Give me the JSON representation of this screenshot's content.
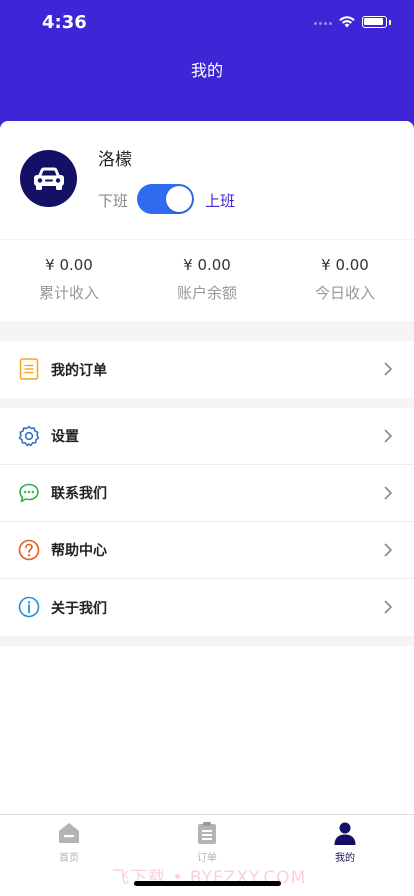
{
  "status_bar": {
    "time": "4:36"
  },
  "header": {
    "title": "我的"
  },
  "profile": {
    "name": "洛檬",
    "status_off_label": "下班",
    "status_on_label": "上班",
    "on_duty": true,
    "avatar_icon": "car-icon"
  },
  "stats": [
    {
      "value": "¥ 0.00",
      "label": "累计收入"
    },
    {
      "value": "¥ 0.00",
      "label": "账户余额"
    },
    {
      "value": "¥ 0.00",
      "label": "今日收入"
    }
  ],
  "menu": {
    "orders": {
      "label": "我的订单",
      "icon": "document-icon"
    },
    "settings": {
      "label": "设置",
      "icon": "gear-icon"
    },
    "contact": {
      "label": "联系我们",
      "icon": "chat-icon"
    },
    "help": {
      "label": "帮助中心",
      "icon": "question-icon"
    },
    "about": {
      "label": "关于我们",
      "icon": "info-icon"
    }
  },
  "tabbar": [
    {
      "label": "首页",
      "icon": "home-icon",
      "active": false
    },
    {
      "label": "订单",
      "icon": "clipboard-icon",
      "active": false
    },
    {
      "label": "我的",
      "icon": "user-icon",
      "active": true
    }
  ],
  "watermark": "飞下载 • BYFZXY.COM",
  "colors": {
    "brand": "#3d26d6",
    "toggle_on": "#2f6cf0",
    "tab_active": "#141066"
  }
}
